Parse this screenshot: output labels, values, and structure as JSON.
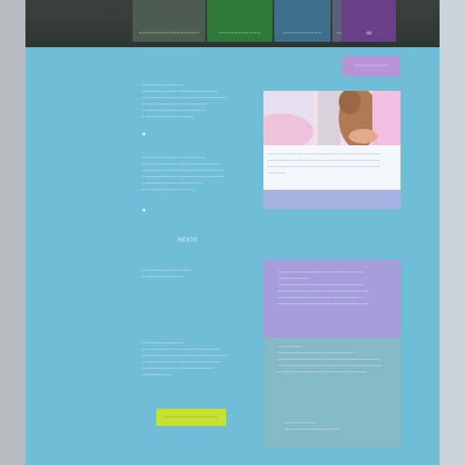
{
  "header": {
    "tabs": [
      {
        "label": "~~~~~~~~~~~~~~~~",
        "color": "#4d5c52"
      },
      {
        "label": "~~~~~~~~~~~",
        "color": "#2f7a3a"
      },
      {
        "label": "~~~~~~~~~~",
        "color": "#3d6e8a"
      },
      {
        "label": "~~~~~~~~",
        "color": "#5a5f7a"
      },
      {
        "label": "dd",
        "color": "#6a3f8a"
      }
    ],
    "accent": "#7e4fb5"
  },
  "intro": {
    "block1": "~~~~~~~~~~~~~~\n~~~~~~~~~~~~~~~~~~~~~~~~~\n~~~~~~~~~~~~~~~~~~~~~~~~~~~~\n~~~~~   ~~~~~~~~~~~~~~~~\n    ~~~~~~~~~~~~~~~~~~~~~\n    ~~~~~~~~~~~~~~~~~",
    "block2": "~~~~~~~~~~~~~~~~~~~~~\n~~~~~~~~~~~~~~~~~~~~~~~~~~\n~~~~~~~~~~~~~~~~~~~~~~~~~~~\n~~~~~~~~~~~~~~~~~~~~~~~~~~~\n    ~~~~~~~~~~~~~~~~~~~~\n    ~~~~~~~~~~~~~~~~~"
  },
  "badge": {
    "label": "~~~~~~~~~"
  },
  "card": {
    "caption": "~~~~~~~~~~~~~~~~~~~~~~~~~~~~~~~~~~~~~\n~~~~~~~~~~~~~~~~~~~~~~~~~~~~~~~~~~~~~\n~~~~~~~~~~~~~~~~~~~~~~~~~~~~~~~~~~~~~\n~~~~~~"
  },
  "section": {
    "label": "REXTE"
  },
  "middle": {
    "block3": "~~~~~~~~~~~~~~~~\n~~~~~~~~~~~~~~",
    "block4": "~~~~~~~~~~~~~~\n~~~~~~~~~~~~~~~~~~~~~~~~~~\n~~~~~~~~~~~~~~~~~~~~~~~~~~~~\n~~~~~~~~~~~~~~~~~~~~~~~~~~\n~~~~~~~~~~~~~~~~~~~~~~~~\n~~~~~~~~~~"
  },
  "panel1": {
    "text": "~~~~~~~~~~~~~~~~~~~~~~~~~~~~\n~~~~~~~~~~\n~~~~~~~~~~~~~~~~~~~~~~~~~~~~\n~~~~~~~~~~~~~~~~~~~~~~~~~~~~~~\n~~~~~~~~~~~~~~~~~~~~~~~~~~~~\n~~~~~~~~~~~~~~~~~~~~~~~~~~~~~~"
  },
  "panel2": {
    "text": "~~~~~~~~\n~~~~~~~~~~~~~~~~~~~~~~~~~\n~~~~~~~~~~~~~~~~~~~~~~~~~~~~~~~~~~\n~~~~~~~~~~~~~~~~~~~~~~~~~~~~~~~~~~\n~~~~~~~~~~~~~~~~~~~~~~~~~~~~~",
    "footer": "~~~~~~~~~~\n~~~~~~~~~~~~~~~~~~"
  },
  "cta": {
    "label": "~~~~~~~~~~~~~~"
  }
}
